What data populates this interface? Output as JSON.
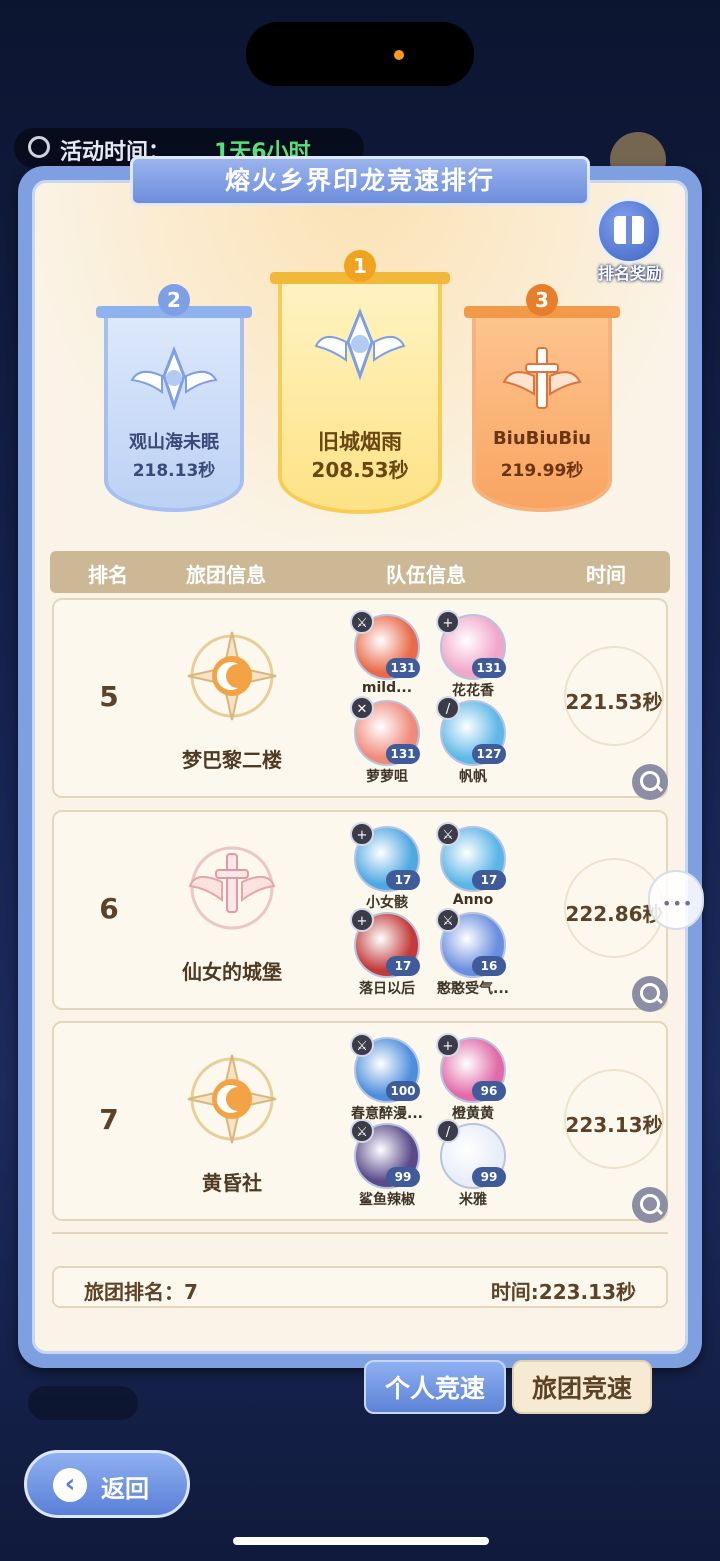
{
  "top_bar": {
    "label": "活动时间：",
    "value": "1天6小时"
  },
  "panel": {
    "title": "熔火乡界印龙竞速排行",
    "reward_button_label": "排名奖励"
  },
  "podium": [
    {
      "rank": "2",
      "name": "观山海未眠",
      "time": "218.13秒"
    },
    {
      "rank": "1",
      "name": "旧城烟雨",
      "time": "208.53秒"
    },
    {
      "rank": "3",
      "name": "BiuBiuBiu",
      "time": "219.99秒"
    }
  ],
  "table": {
    "headers": {
      "rank": "排名",
      "guild": "旅团信息",
      "team": "队伍信息",
      "time": "时间"
    },
    "rows": [
      {
        "rank": "5",
        "guild": "梦巴黎二楼",
        "time": "221.53秒",
        "emblem": "moon",
        "members": [
          {
            "name": "mild...",
            "level": "131",
            "class_icon": "sword-icon",
            "color": "#e96a4a"
          },
          {
            "name": "花花香",
            "level": "131",
            "class_icon": "plus-icon",
            "color": "#f2a6c8"
          },
          {
            "name": "萝萝咀",
            "level": "131",
            "class_icon": "cross-icon",
            "color": "#f08a7a"
          },
          {
            "name": "帆帆",
            "level": "127",
            "class_icon": "wand-icon",
            "color": "#5fb8e8"
          }
        ]
      },
      {
        "rank": "6",
        "guild": "仙女的城堡",
        "time": "222.86秒",
        "emblem": "sword-wings",
        "members": [
          {
            "name": "小女骸",
            "level": "17",
            "class_icon": "plus-icon",
            "color": "#4fa8e2"
          },
          {
            "name": "Anno",
            "level": "17",
            "class_icon": "sword-icon",
            "color": "#5ab6e6"
          },
          {
            "name": "落日以后",
            "level": "17",
            "class_icon": "plus-icon",
            "color": "#c23a3a"
          },
          {
            "name": "憨憨受气...",
            "level": "16",
            "class_icon": "sword-icon",
            "color": "#6a8ee0"
          }
        ]
      },
      {
        "rank": "7",
        "guild": "黄昏社",
        "time": "223.13秒",
        "emblem": "moon",
        "members": [
          {
            "name": "春意醉漫...",
            "level": "100",
            "class_icon": "sword-icon",
            "color": "#4d8fdc"
          },
          {
            "name": "橙黄黄",
            "level": "96",
            "class_icon": "plus-icon",
            "color": "#e26aa8"
          },
          {
            "name": "鲨鱼辣椒",
            "level": "99",
            "class_icon": "sword-icon",
            "color": "#5a4a8a"
          },
          {
            "name": "米雅",
            "level": "99",
            "class_icon": "wand-icon",
            "color": "#e8eef8"
          }
        ]
      }
    ]
  },
  "footer": {
    "guild_rank_label": "旅团排名：7",
    "time_label": "时间:223.13秒"
  },
  "tabs": {
    "personal": "个人竞速",
    "guild": "旅团竞速",
    "active": "personal"
  },
  "back_button": {
    "label": "返回"
  }
}
